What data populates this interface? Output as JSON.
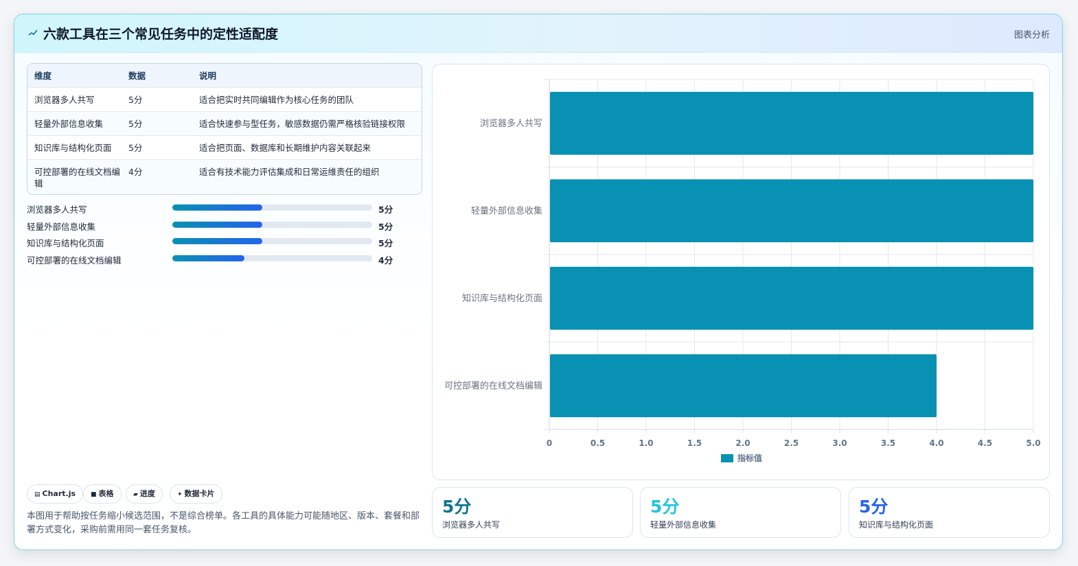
{
  "header": {
    "title": "六款工具在三个常见任务中的定性适配度",
    "right_label": "图表分析"
  },
  "table": {
    "headers": [
      "维度",
      "数据",
      "说明"
    ],
    "rows": [
      {
        "dim": "浏览器多人共写",
        "value": "5分",
        "desc": "适合把实时共同编辑作为核心任务的团队"
      },
      {
        "dim": "轻量外部信息收集",
        "value": "5分",
        "desc": "适合快速参与型任务，敏感数据仍需严格核验链接权限"
      },
      {
        "dim": "知识库与结构化页面",
        "value": "5分",
        "desc": "适合把页面、数据库和长期维护内容关联起来"
      },
      {
        "dim": "可控部署的在线文档编辑",
        "value": "4分",
        "desc": "适合有技术能力评估集成和日常运维责任的组织"
      }
    ]
  },
  "progress": [
    {
      "label": "浏览器多人共写",
      "value": "5分",
      "fraction": 0.45
    },
    {
      "label": "轻量外部信息收集",
      "value": "5分",
      "fraction": 0.45
    },
    {
      "label": "知识库与结构化页面",
      "value": "5分",
      "fraction": 0.45
    },
    {
      "label": "可控部署的在线文档编辑",
      "value": "4分",
      "fraction": 0.36
    }
  ],
  "tags": [
    {
      "icon": "chart-icon",
      "glyph": "▤",
      "label": "Chart.js"
    },
    {
      "icon": "table-icon",
      "glyph": "■",
      "label": "表格"
    },
    {
      "icon": "progress-icon",
      "glyph": "▰",
      "label": "进度"
    },
    {
      "icon": "card-icon",
      "glyph": "✦",
      "label": "数据卡片"
    }
  ],
  "note": "本图用于帮助按任务缩小候选范围，不是综合榜单。各工具的具体能力可能随地区、版本、套餐和部署方式变化，采购前需用同一套任务复核。",
  "chart_data": {
    "type": "bar",
    "orientation": "horizontal",
    "categories": [
      "浏览器多人共写",
      "轻量外部信息收集",
      "知识库与结构化页面",
      "可控部署的在线文档编辑"
    ],
    "series": [
      {
        "name": "指标值",
        "values": [
          5,
          5,
          5,
          4
        ]
      }
    ],
    "xlim": [
      0,
      5
    ],
    "xticks": [
      "0",
      "0.5",
      "1.0",
      "1.5",
      "2.0",
      "2.5",
      "3.0",
      "3.5",
      "4.0",
      "4.5",
      "5.0"
    ],
    "grid": true,
    "legend": "bottom",
    "bar_color": "#0891b2"
  },
  "stats": [
    {
      "value": "5分",
      "label": "浏览器多人共写",
      "color": "#0e7490"
    },
    {
      "value": "5分",
      "label": "轻量外部信息收集",
      "color": "#22c5dd"
    },
    {
      "value": "5分",
      "label": "知识库与结构化页面",
      "color": "#2563eb"
    }
  ]
}
